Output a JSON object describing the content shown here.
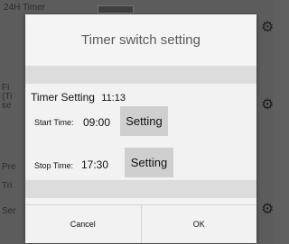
{
  "background": {
    "items": [
      {
        "key": "timer_label",
        "text": "24H Timer"
      },
      {
        "key": "fi",
        "text": "Fi"
      },
      {
        "key": "t_paren",
        "text": "(Ti"
      },
      {
        "key": "se",
        "text": "se"
      },
      {
        "key": "pre",
        "text": "Pre"
      },
      {
        "key": "tri",
        "text": "Tri"
      },
      {
        "key": "ser",
        "text": "Ser"
      }
    ]
  },
  "dialog": {
    "title": "Timer switch setting",
    "timer_setting_label": "Timer Setting",
    "current_time": "11:13",
    "start": {
      "label": "Start Time:",
      "value": "09:00",
      "button": "Setting"
    },
    "stop": {
      "label": "Stop Time:",
      "value": "17:30",
      "button": "Setting"
    },
    "cancel": "Cancel",
    "ok": "OK"
  }
}
